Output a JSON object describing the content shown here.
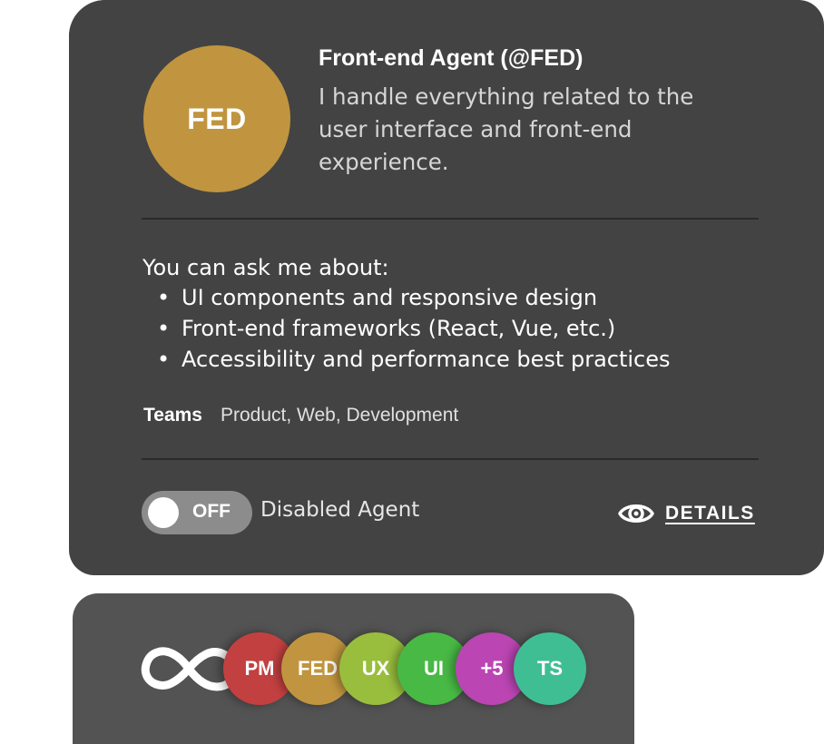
{
  "agent": {
    "avatar_initials": "FED",
    "avatar_color": "#c1953f",
    "name": "Front-end Agent (@FED)",
    "description": "I handle everything related to the user interface and front-end experience."
  },
  "capabilities": {
    "title": "You can ask me about:",
    "items": [
      "UI components and responsive design",
      "Front-end frameworks (React, Vue, etc.)",
      "Accessibility and performance best practices"
    ]
  },
  "teams": {
    "label": "Teams",
    "value": "Product, Web, Development"
  },
  "status": {
    "toggle_label": "OFF",
    "toggle_on": false,
    "caption": "Disabled Agent"
  },
  "details": {
    "label": "DETAILS",
    "icon": "eye-icon"
  },
  "team_bar": {
    "icon": "infinity-icon",
    "members": [
      {
        "label": "PM",
        "color": "#c34040"
      },
      {
        "label": "FED",
        "color": "#c1953f"
      },
      {
        "label": "UX",
        "color": "#99be3d"
      },
      {
        "label": "UI",
        "color": "#48b945"
      },
      {
        "label": "+5",
        "color": "#bb45b3"
      },
      {
        "label": "TS",
        "color": "#3fbe94"
      }
    ]
  },
  "colors": {
    "card_bg": "#434343",
    "team_card_bg": "#535353",
    "toggle_off": "#8c8c8c"
  }
}
